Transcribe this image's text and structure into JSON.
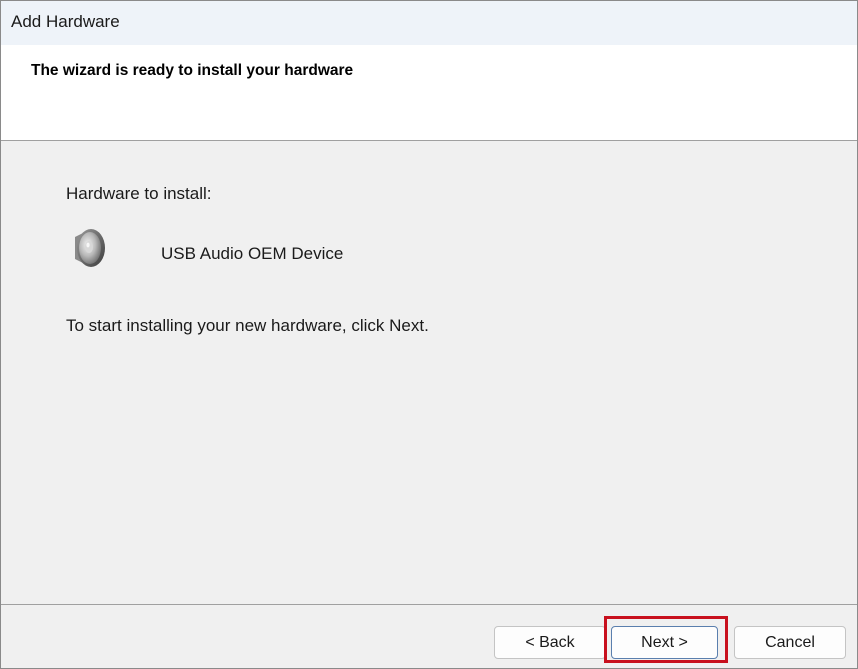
{
  "window": {
    "title": "Add Hardware"
  },
  "header": {
    "title": "The wizard is ready to install your hardware"
  },
  "body": {
    "hardware_label": "Hardware to install:",
    "device_name": "USB Audio OEM Device",
    "device_icon": "speaker-icon",
    "instruction": "To start installing your new hardware, click Next."
  },
  "buttons": {
    "back": "< Back",
    "next": "Next >",
    "cancel": "Cancel"
  },
  "colors": {
    "highlight": "#c8101e",
    "titlebar": "#eef3f9",
    "panel": "#f0f0f0"
  }
}
